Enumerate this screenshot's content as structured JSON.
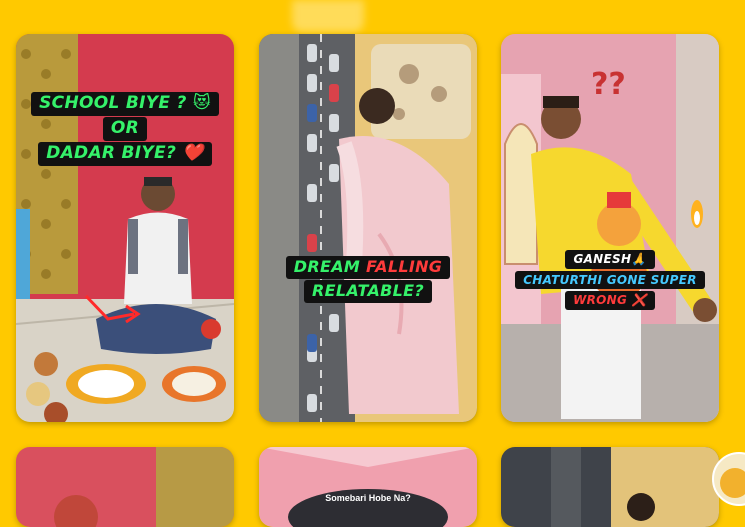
{
  "reels": [
    {
      "id": "reel-1",
      "caption_lines": [
        "SCHOOL BIYE ? 😻",
        "OR",
        "DADAR BIYE? ❤️"
      ],
      "accent": "#35F26A"
    },
    {
      "id": "reel-2",
      "caption_line1_a": "DREAM",
      "caption_line1_b": "FALLING",
      "caption_line2": "RELATABLE?"
    },
    {
      "id": "reel-3",
      "caption_line1": "GANESH🙏",
      "caption_line2": "CHATURTHI GONE SUPER",
      "caption_line3": "WRONG ❌"
    }
  ],
  "bottom_row": {
    "reel5_caption": "Somebari Hobe Na?"
  },
  "colors": {
    "background": "#FFC900",
    "caption_green": "#35F26A",
    "caption_red": "#FF3B3B",
    "caption_blue": "#45C9FF"
  }
}
